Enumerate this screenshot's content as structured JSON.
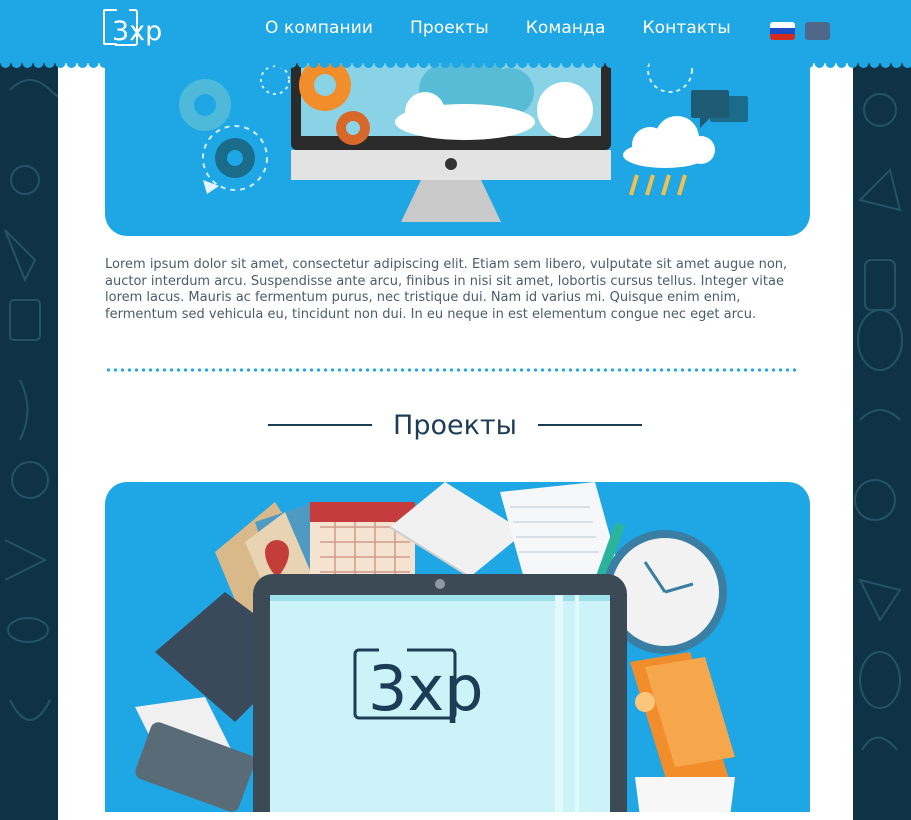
{
  "header": {
    "logo_text": "3xp",
    "nav": [
      {
        "label": "О компании"
      },
      {
        "label": "Проекты"
      },
      {
        "label": "Команда"
      },
      {
        "label": "Контакты"
      }
    ],
    "languages": [
      "ru",
      "cn"
    ]
  },
  "about": {
    "text": "Lorem ipsum dolor sit amet, consectetur adipiscing elit. Etiam sem libero, vulputate sit amet augue non, auctor interdum arcu. Suspendisse ante arcu, finibus in nisi sit amet, lobortis cursus tellus. Integer vitae lorem lacus. Mauris ac fermentum purus, nec tristique dui. Nam id varius mi. Quisque enim enim, fermentum sed vehicula eu, tincidunt non dui. In eu neque in est elementum congue nec eget arcu."
  },
  "projects": {
    "title": "Проекты",
    "tablet_logo": "3xp"
  },
  "colors": {
    "accent": "#1ea7e4",
    "dark": "#1d3c55",
    "background": "#0f3346"
  }
}
